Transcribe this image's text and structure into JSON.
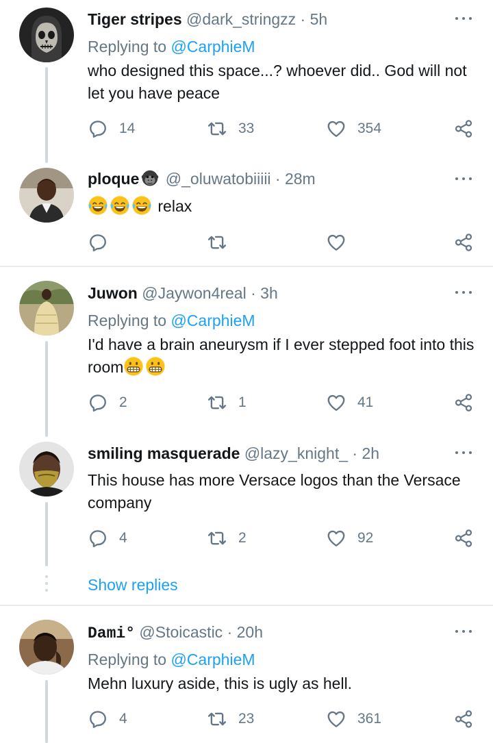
{
  "tweets": [
    {
      "name": "Tiger stripes",
      "handle": "@dark_stringzz · 5h",
      "replying_label": "Replying to",
      "replying_to": "@CarphieM",
      "text": "who designed this space...?  whoever did.. God will not let you have peace",
      "replies": "14",
      "retweets": "33",
      "likes": "354"
    },
    {
      "name": "ploque",
      "handle": "@_oluwatobiiiii · 28m",
      "text": "relax",
      "replies": "",
      "retweets": "",
      "likes": ""
    },
    {
      "name": "Juwon",
      "handle": "@Jaywon4real · 3h",
      "replying_label": "Replying to",
      "replying_to": "@CarphieM",
      "text": "I'd have a brain aneurysm if I ever stepped foot into this room",
      "replies": "2",
      "retweets": "1",
      "likes": "41"
    },
    {
      "name": "smiling masquerade",
      "handle": "@lazy_knight_ · 2h",
      "text": "This house has more Versace logos than the Versace company",
      "replies": "4",
      "retweets": "2",
      "likes": "92"
    },
    {
      "name": "Dami°",
      "handle": "@Stoicastic · 20h",
      "replying_label": "Replying to",
      "replying_to": "@CarphieM",
      "text": "Mehn luxury aside, this is ugly as hell.",
      "replies": "4",
      "retweets": "23",
      "likes": "361"
    }
  ],
  "show_replies": "Show replies",
  "icons": {
    "reply": "reply-icon",
    "retweet": "retweet-icon",
    "like": "heart-icon",
    "share": "share-icon",
    "more": "more-icon",
    "name_emoji": "gorilla-emoji",
    "laugh": "tears-of-joy-emoji",
    "grimace": "grimacing-emoji"
  },
  "colors": {
    "link": "#1da1f2",
    "secondary_text": "#657786",
    "thread_line": "#cfd9de",
    "separator": "#e6ecf0"
  }
}
